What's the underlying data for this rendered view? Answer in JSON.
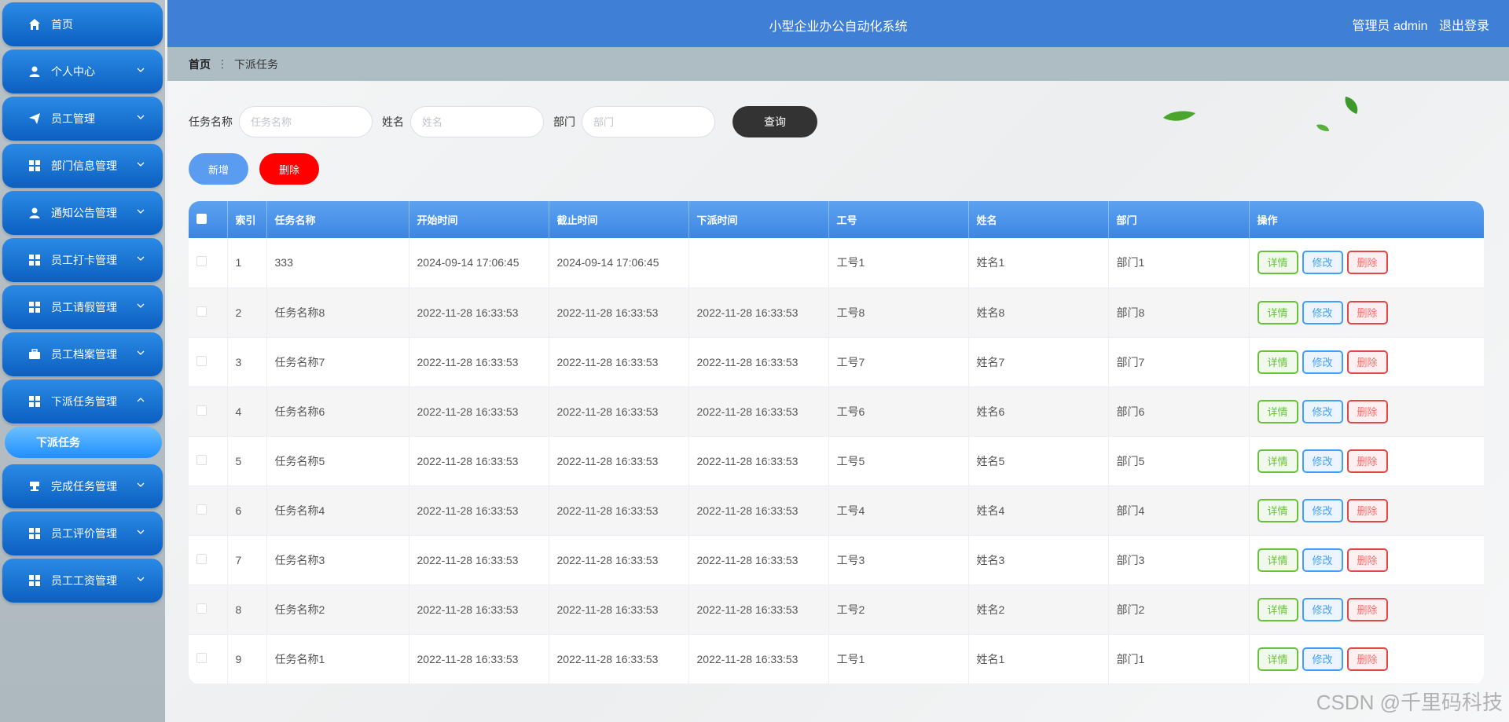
{
  "header": {
    "title": "小型企业办公自动化系统",
    "user": "管理员 admin",
    "logout": "退出登录"
  },
  "sidebar": {
    "items": [
      {
        "label": "首页",
        "icon": "home-icon"
      },
      {
        "label": "个人中心",
        "icon": "user-icon"
      },
      {
        "label": "员工管理",
        "icon": "send-icon"
      },
      {
        "label": "部门信息管理",
        "icon": "grid-icon"
      },
      {
        "label": "通知公告管理",
        "icon": "user-icon"
      },
      {
        "label": "员工打卡管理",
        "icon": "grid-icon"
      },
      {
        "label": "员工请假管理",
        "icon": "grid-icon"
      },
      {
        "label": "员工档案管理",
        "icon": "briefcase-icon"
      },
      {
        "label": "下派任务管理",
        "icon": "grid-icon"
      },
      {
        "label": "完成任务管理",
        "icon": "stamp-icon"
      },
      {
        "label": "员工评价管理",
        "icon": "grid-icon"
      },
      {
        "label": "员工工资管理",
        "icon": "grid-icon"
      }
    ],
    "submenu": "下派任务"
  },
  "breadcrumb": {
    "home": "首页",
    "current": "下派任务"
  },
  "search": {
    "task_label": "任务名称",
    "task_placeholder": "任务名称",
    "name_label": "姓名",
    "name_placeholder": "姓名",
    "dept_label": "部门",
    "dept_placeholder": "部门",
    "query": "查询"
  },
  "actions": {
    "add": "新增",
    "delete": "删除"
  },
  "table": {
    "headers": [
      "索引",
      "任务名称",
      "开始时间",
      "截止时间",
      "下派时间",
      "工号",
      "姓名",
      "部门",
      "操作"
    ],
    "rows": [
      [
        "1",
        "333",
        "2024-09-14 17:06:45",
        "2024-09-14 17:06:45",
        "",
        "工号1",
        "姓名1",
        "部门1"
      ],
      [
        "2",
        "任务名称8",
        "2022-11-28 16:33:53",
        "2022-11-28 16:33:53",
        "2022-11-28 16:33:53",
        "工号8",
        "姓名8",
        "部门8"
      ],
      [
        "3",
        "任务名称7",
        "2022-11-28 16:33:53",
        "2022-11-28 16:33:53",
        "2022-11-28 16:33:53",
        "工号7",
        "姓名7",
        "部门7"
      ],
      [
        "4",
        "任务名称6",
        "2022-11-28 16:33:53",
        "2022-11-28 16:33:53",
        "2022-11-28 16:33:53",
        "工号6",
        "姓名6",
        "部门6"
      ],
      [
        "5",
        "任务名称5",
        "2022-11-28 16:33:53",
        "2022-11-28 16:33:53",
        "2022-11-28 16:33:53",
        "工号5",
        "姓名5",
        "部门5"
      ],
      [
        "6",
        "任务名称4",
        "2022-11-28 16:33:53",
        "2022-11-28 16:33:53",
        "2022-11-28 16:33:53",
        "工号4",
        "姓名4",
        "部门4"
      ],
      [
        "7",
        "任务名称3",
        "2022-11-28 16:33:53",
        "2022-11-28 16:33:53",
        "2022-11-28 16:33:53",
        "工号3",
        "姓名3",
        "部门3"
      ],
      [
        "8",
        "任务名称2",
        "2022-11-28 16:33:53",
        "2022-11-28 16:33:53",
        "2022-11-28 16:33:53",
        "工号2",
        "姓名2",
        "部门2"
      ],
      [
        "9",
        "任务名称1",
        "2022-11-28 16:33:53",
        "2022-11-28 16:33:53",
        "2022-11-28 16:33:53",
        "工号1",
        "姓名1",
        "部门1"
      ]
    ],
    "ops": {
      "detail": "详情",
      "edit": "修改",
      "delete": "删除"
    }
  },
  "watermark": "CSDN @千里码科技"
}
